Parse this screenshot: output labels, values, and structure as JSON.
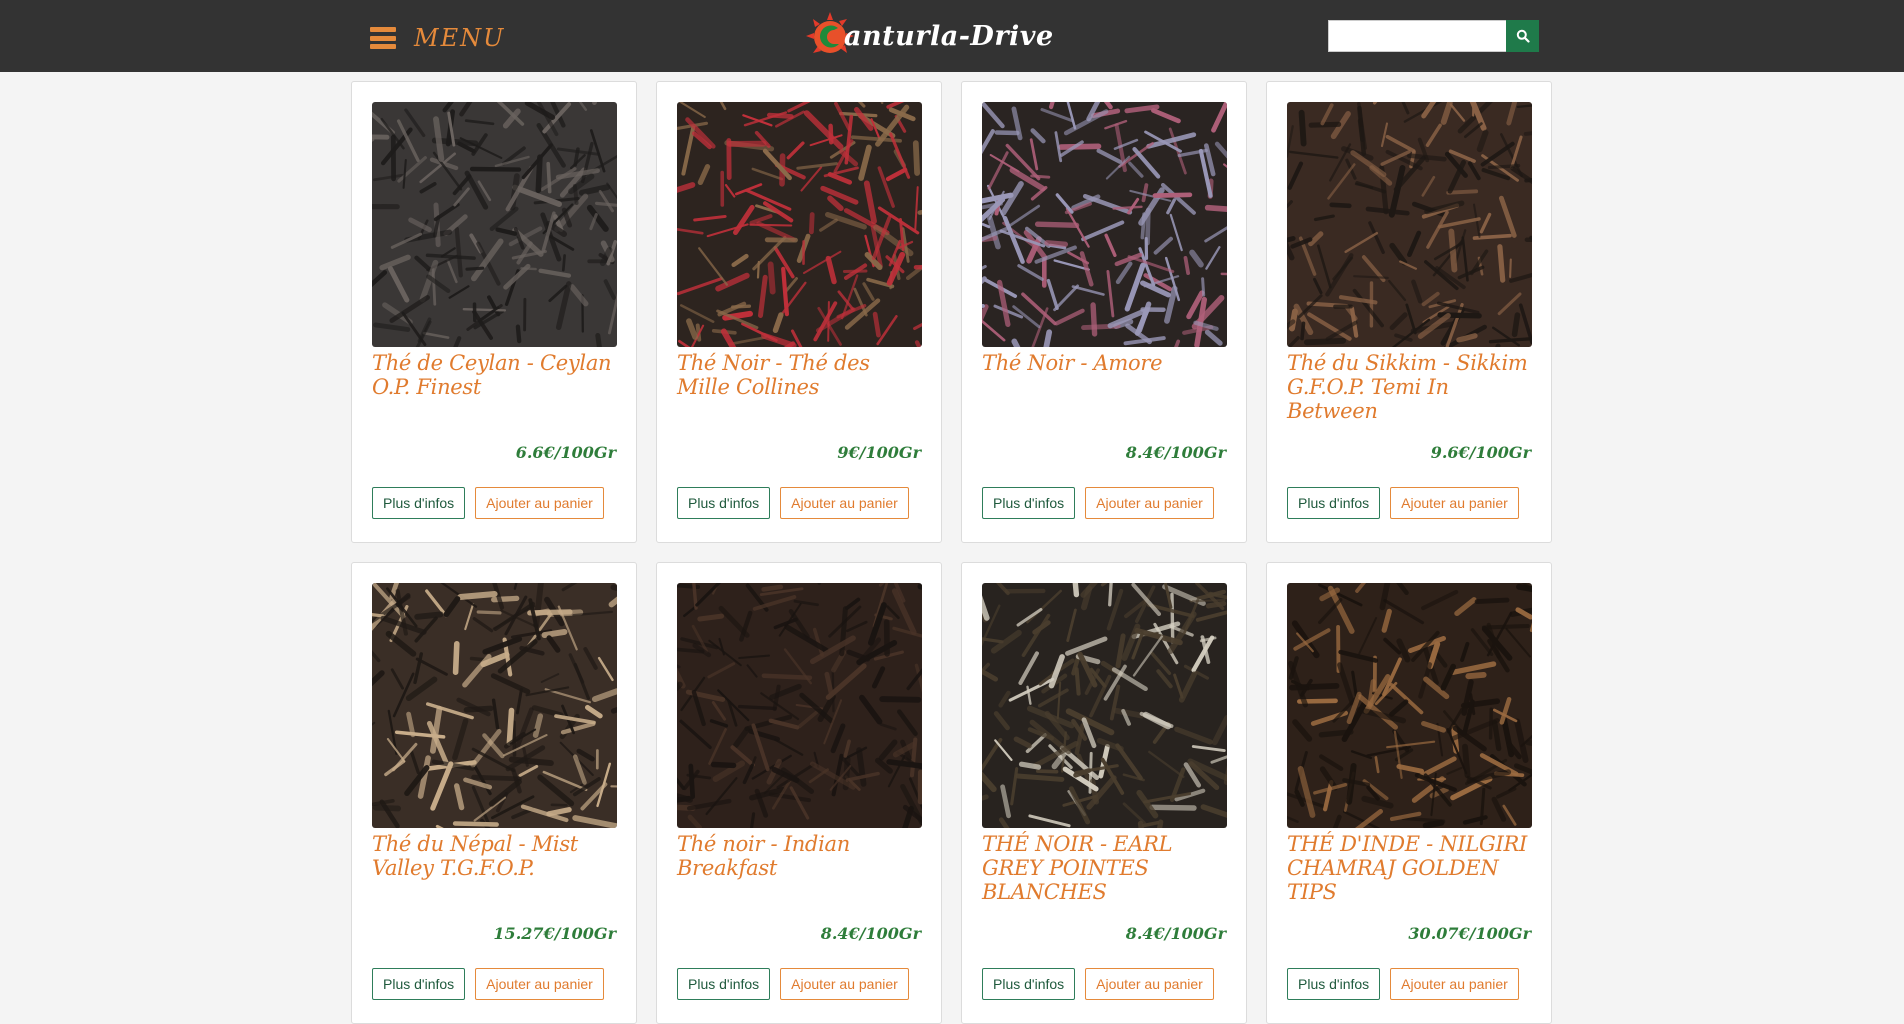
{
  "header": {
    "menu_label": "MENU",
    "logo_text": "anturla-Drive",
    "search": {
      "value": "",
      "placeholder": ""
    }
  },
  "colors": {
    "topbar": "#333333",
    "accent_orange": "#e58a3b",
    "accent_green": "#1f7a4a",
    "price_green": "#2e7d3a"
  },
  "buttons": {
    "info_label": "Plus d'infos",
    "cart_label": "Ajouter au panier"
  },
  "products": [
    {
      "title": "Thé de Ceylan - Ceylan O.P. Finest",
      "price": "6.6€/100Gr",
      "tone": [
        "#3a3736",
        "#6b6460",
        "#1e1c1b"
      ]
    },
    {
      "title": "Thé Noir - Thé des Mille Collines",
      "price": "9€/100Gr",
      "tone": [
        "#2d241f",
        "#8a6a4a",
        "#c0303a"
      ]
    },
    {
      "title": "Thé Noir - Amore",
      "price": "8.4€/100Gr",
      "tone": [
        "#2a2422",
        "#b0607a",
        "#9a98b8"
      ]
    },
    {
      "title": "Thé du Sikkim - Sikkim G.F.O.P. Temi In Between",
      "price": "9.6€/100Gr",
      "tone": [
        "#3a2a22",
        "#8a6246",
        "#1e1814"
      ]
    },
    {
      "title": "Thé du Népal - Mist Valley T.G.F.O.P.",
      "price": "15.27€/100Gr",
      "tone": [
        "#3a2e26",
        "#c8ad8a",
        "#1f1915"
      ]
    },
    {
      "title": "Thé noir - Indian Breakfast",
      "price": "8.4€/100Gr",
      "tone": [
        "#2e211b",
        "#4a3428",
        "#1a1411"
      ]
    },
    {
      "title": "THÉ NOIR - EARL GREY POINTES BLANCHES",
      "price": "8.4€/100Gr",
      "tone": [
        "#28231f",
        "#d6d0c2",
        "#4a3e2e"
      ]
    },
    {
      "title": "THÉ D'INDE - NILGIRI CHAMRAJ GOLDEN TIPS",
      "price": "30.07€/100Gr",
      "tone": [
        "#2e2119",
        "#9a6a40",
        "#1a130e"
      ]
    }
  ]
}
